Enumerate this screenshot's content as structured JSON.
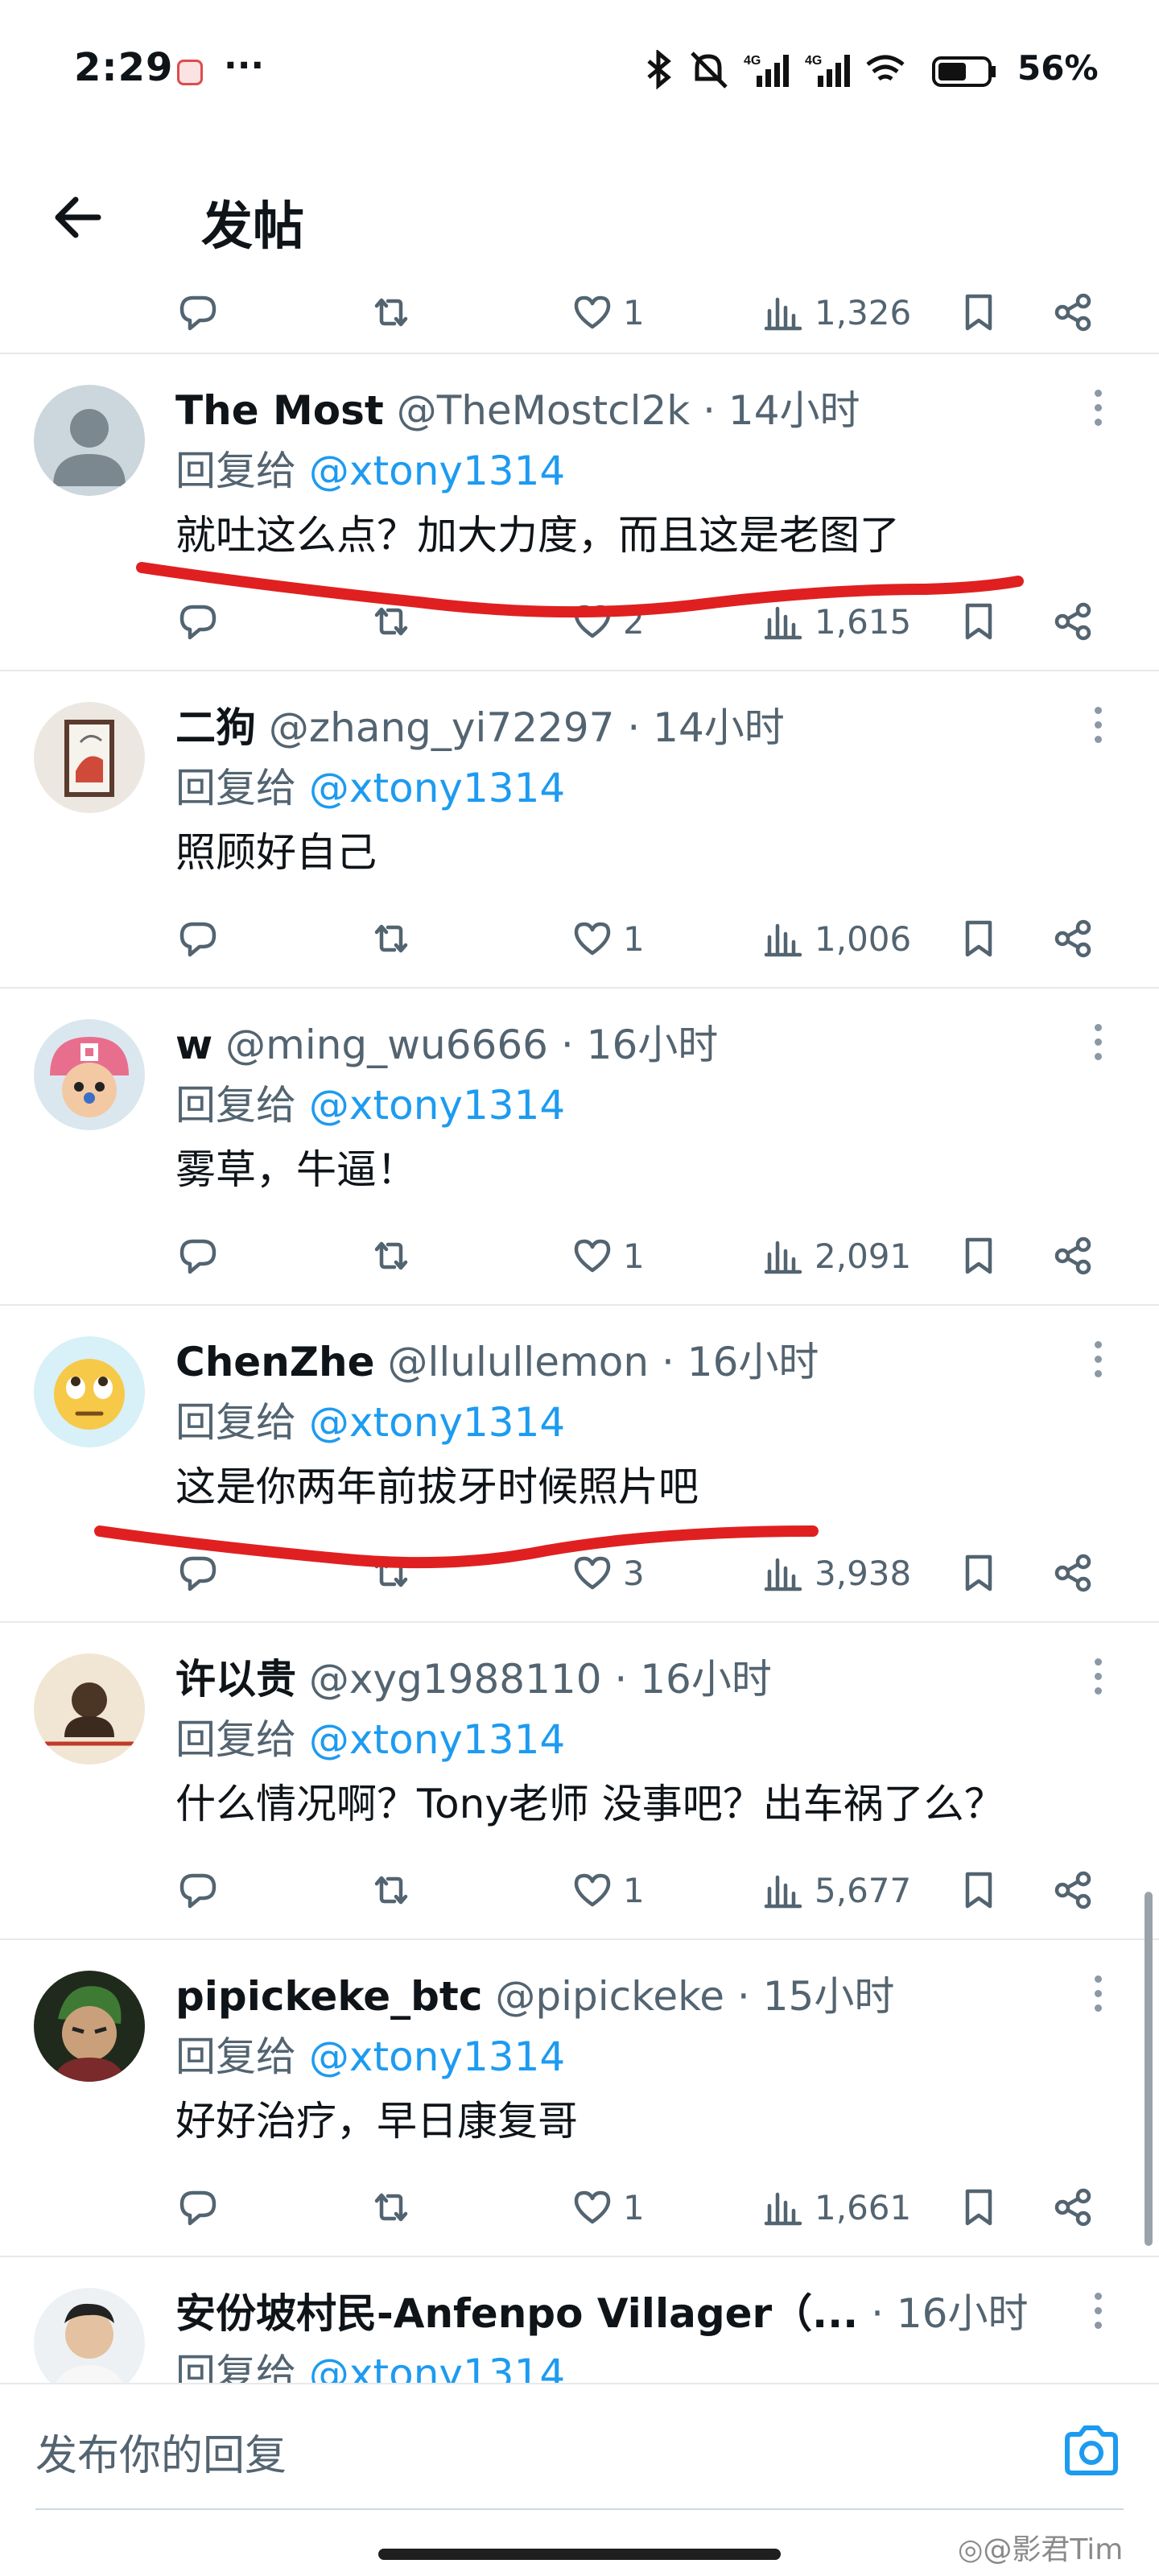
{
  "status_bar": {
    "time": "2:29",
    "overflow": "···",
    "network": "4G",
    "battery": "56%"
  },
  "header": {
    "title": "发帖"
  },
  "reply_prefix": "回复给",
  "posts": [
    {
      "name": "The Most",
      "handle": "@TheMostcl2k",
      "time": "· 14小时",
      "reply_to": "@xtony1314",
      "text": "就吐这么点？加大力度，而且这是老图了",
      "likes": "2",
      "views": "1,615",
      "avatar": "default"
    },
    {
      "name": "二狗",
      "handle": "@zhang_yi72297",
      "time": "· 14小时",
      "reply_to": "@xtony1314",
      "text": "照顾好自己",
      "likes": "1",
      "views": "1,006",
      "avatar": "painting"
    },
    {
      "name": "w",
      "handle": "@ming_wu6666",
      "time": "· 16小时",
      "reply_to": "@xtony1314",
      "text": "雾草，牛逼！",
      "likes": "1",
      "views": "2,091",
      "avatar": "cartoon"
    },
    {
      "name": "ChenZhe",
      "handle": "@llulullemon",
      "time": "· 16小时",
      "reply_to": "@xtony1314",
      "text": "这是你两年前拔牙时候照片吧",
      "likes": "3",
      "views": "3,938",
      "avatar": "emoji"
    },
    {
      "name": "许以贵",
      "handle": "@xyg1988110",
      "time": "· 16小时",
      "reply_to": "@xtony1314",
      "text": "什么情况啊？Tony老师  没事吧？出车祸了么？",
      "likes": "1",
      "views": "5,677",
      "avatar": "portrait"
    },
    {
      "name": "pipickeke_btc",
      "handle": "@pipickeke",
      "time": "· 15小时",
      "reply_to": "@xtony1314",
      "text": "好好治疗，早日康复哥",
      "likes": "1",
      "views": "1,661",
      "avatar": "anime"
    },
    {
      "name": "安份坡村民-Anfenpo Villager（...",
      "handle": "",
      "time": "· 16小时",
      "reply_to": "@xtony1314",
      "text": "",
      "likes": "",
      "views": "",
      "avatar": "photo"
    }
  ],
  "partial_top": {
    "likes": "1",
    "views": "1,326"
  },
  "composer": {
    "placeholder": "发布你的回复"
  },
  "watermark": "◎@影君Tim",
  "colors": {
    "link": "#1d9bf0",
    "secondary_text": "#536471",
    "markup_red": "#e02020"
  }
}
